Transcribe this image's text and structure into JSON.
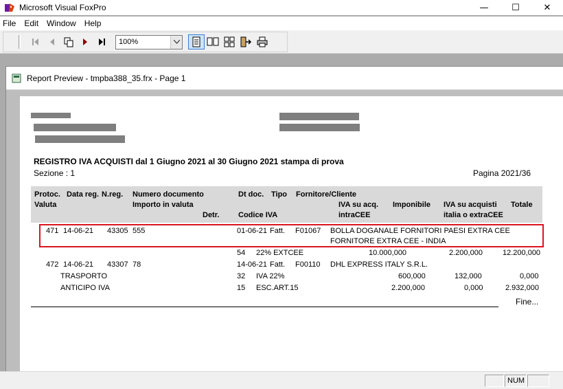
{
  "window": {
    "title": "Microsoft Visual FoxPro",
    "minimize_glyph": "—",
    "maximize_glyph": "☐",
    "close_glyph": "✕"
  },
  "menu": [
    "File",
    "Edit",
    "Window",
    "Help"
  ],
  "toolbar": {
    "zoom_value": "100%",
    "icons": [
      "first-page-icon",
      "previous-page-icon",
      "go-to-page-icon",
      "next-page-icon",
      "last-page-icon",
      "one-page-icon",
      "two-pages-icon",
      "four-pages-icon",
      "close-preview-icon",
      "print-icon"
    ]
  },
  "preview": {
    "title": "Report Preview - tmpba388_35.frx - Page 1"
  },
  "report": {
    "title": "REGISTRO IVA ACQUISTI dal 1 Giugno 2021 al 30 Giugno 2021 stampa di prova",
    "sezione": "Sezione : 1",
    "pagina": "Pagina 2021/36",
    "headers": {
      "protoc": "Protoc.",
      "data_reg": "Data reg.",
      "n_reg": "N.reg.",
      "numero_documento": "Numero documento",
      "dt_doc": "Dt doc.",
      "tipo": "Tipo",
      "fornitore": "Fornitore/Cliente",
      "valuta": "Valuta",
      "importo_valuta": "Importo in valuta",
      "iva_intra_1": "IVA su acq.",
      "iva_intra_2": "intraCEE",
      "imponibile": "Imponibile",
      "iva_extra_1": "IVA su acquisti",
      "iva_extra_2": "italia o extraCEE",
      "totale": "Totale",
      "detr": "Detr.",
      "codice_iva": "Codice IVA"
    },
    "rows": {
      "r1": {
        "protoc": "471",
        "data_reg": "14-06-21",
        "n_reg": "43305",
        "num_doc": "555",
        "dt_doc": "01-06-21",
        "tipo": "Fatt.",
        "codice": "F01067",
        "fornitore_1": "BOLLA DOGANALE FORNITORI PAESI EXTRA CEE",
        "fornitore_2": "FORNITORE EXTRA CEE - INDIA"
      },
      "r1_iva": {
        "codice": "54",
        "descr": "22% EXTCEE",
        "iva_intra": "10.000,000",
        "iva_extra": "2.200,000",
        "totale": "12.200,000"
      },
      "r2": {
        "protoc": "472",
        "data_reg": "14-06-21",
        "n_reg": "43307",
        "num_doc": "78",
        "dt_doc": "14-06-21",
        "tipo": "Fatt.",
        "codice": "F00110",
        "fornitore_1": "DHL EXPRESS ITALY S.R.L."
      },
      "r2_line1": {
        "descr": "TRASPORTO",
        "codice": "32",
        "iva": "IVA 22%",
        "imponibile": "600,000",
        "iva_extra": "132,000",
        "totale": "0,000"
      },
      "r2_line2": {
        "descr": "ANTICIPO IVA",
        "codice": "15",
        "iva": "ESC.ART.15",
        "imponibile": "2.200,000",
        "iva_extra": "0,000",
        "totale": "2.932,000"
      }
    },
    "fine": "Fine..."
  },
  "status": {
    "num": "NUM"
  }
}
